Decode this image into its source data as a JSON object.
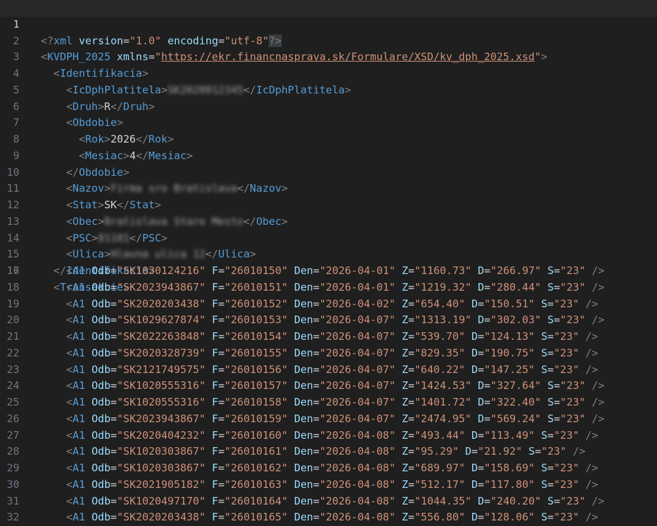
{
  "line_numbers": [
    "1",
    "2",
    "3",
    "4",
    "5",
    "6",
    "7",
    "8",
    "9",
    "10",
    "11",
    "12",
    "13",
    "14",
    "15",
    "16",
    "17",
    "18",
    "19",
    "20",
    "21",
    "22",
    "23",
    "24",
    "25",
    "26",
    "27",
    "28",
    "29",
    "30",
    "31",
    "32"
  ],
  "header": {
    "xml_decl_name": "xml",
    "version_attr": "version",
    "version_val": "\"1.0\"",
    "encoding_attr": "encoding",
    "encoding_val": "\"utf-8\"",
    "root_tag": "KVDPH_2025",
    "xmlns_attr": "xmlns",
    "xmlns_url": "https://ekr.financnasprava.sk/Formulare/XSD/kv_dph_2025.xsd"
  },
  "identifikacia": {
    "tag": "Identifikacia",
    "ic_tag": "IcDphPlatitela",
    "ic_value_blurred": "SK2020012345",
    "druh_tag": "Druh",
    "druh_value": "R",
    "obdobie_tag": "Obdobie",
    "rok_tag": "Rok",
    "rok_value": "2026",
    "mesiac_tag": "Mesiac",
    "mesiac_value": "4",
    "nazov_tag": "Nazov",
    "nazov_value_blurred": "Firma sro Bratislava",
    "stat_tag": "Stat",
    "stat_value": "SK",
    "obec_tag": "Obec",
    "obec_value_blurred": "Bratislava Stare Mesto",
    "psc_tag": "PSC",
    "psc_value_blurred": "81101",
    "ulica_tag": "Ulica",
    "ulica_value_blurred": "Hlavna ulica 12"
  },
  "transakcie_tag": "Transakcie",
  "transactions": [
    {
      "tag": "A1",
      "odb": "\"SK1030124216\"",
      "f": "\"26010150\"",
      "den": "\"2026-04-01\"",
      "z": "\"1160.73\"",
      "d": "\"266.97\"",
      "s": "\"23\""
    },
    {
      "tag": "A1",
      "odb": "\"SK2023943867\"",
      "f": "\"26010151\"",
      "den": "\"2026-04-01\"",
      "z": "\"1219.32\"",
      "d": "\"280.44\"",
      "s": "\"23\""
    },
    {
      "tag": "A1",
      "odb": "\"SK2020203438\"",
      "f": "\"26010152\"",
      "den": "\"2026-04-02\"",
      "z": "\"654.40\"",
      "d": "\"150.51\"",
      "s": "\"23\""
    },
    {
      "tag": "A1",
      "odb": "\"SK1029627874\"",
      "f": "\"26010153\"",
      "den": "\"2026-04-07\"",
      "z": "\"1313.19\"",
      "d": "\"302.03\"",
      "s": "\"23\""
    },
    {
      "tag": "A1",
      "odb": "\"SK2022263848\"",
      "f": "\"26010154\"",
      "den": "\"2026-04-07\"",
      "z": "\"539.70\"",
      "d": "\"124.13\"",
      "s": "\"23\""
    },
    {
      "tag": "A1",
      "odb": "\"SK2020328739\"",
      "f": "\"26010155\"",
      "den": "\"2026-04-07\"",
      "z": "\"829.35\"",
      "d": "\"190.75\"",
      "s": "\"23\""
    },
    {
      "tag": "A1",
      "odb": "\"SK2121749575\"",
      "f": "\"26010156\"",
      "den": "\"2026-04-07\"",
      "z": "\"640.22\"",
      "d": "\"147.25\"",
      "s": "\"23\""
    },
    {
      "tag": "A1",
      "odb": "\"SK1020555316\"",
      "f": "\"26010157\"",
      "den": "\"2026-04-07\"",
      "z": "\"1424.53\"",
      "d": "\"327.64\"",
      "s": "\"23\""
    },
    {
      "tag": "A1",
      "odb": "\"SK1020555316\"",
      "f": "\"26010158\"",
      "den": "\"2026-04-07\"",
      "z": "\"1401.72\"",
      "d": "\"322.40\"",
      "s": "\"23\""
    },
    {
      "tag": "A1",
      "odb": "\"SK2023943867\"",
      "f": "\"26010159\"",
      "den": "\"2026-04-07\"",
      "z": "\"2474.95\"",
      "d": "\"569.24\"",
      "s": "\"23\""
    },
    {
      "tag": "A1",
      "odb": "\"SK2020404232\"",
      "f": "\"26010160\"",
      "den": "\"2026-04-08\"",
      "z": "\"493.44\"",
      "d": "\"113.49\"",
      "s": "\"23\""
    },
    {
      "tag": "A1",
      "odb": "\"SK1020303867\"",
      "f": "\"26010161\"",
      "den": "\"2026-04-08\"",
      "z": "\"95.29\"",
      "d": "\"21.92\"",
      "s": "\"23\""
    },
    {
      "tag": "A1",
      "odb": "\"SK1020303867\"",
      "f": "\"26010162\"",
      "den": "\"2026-04-08\"",
      "z": "\"689.97\"",
      "d": "\"158.69\"",
      "s": "\"23\""
    },
    {
      "tag": "A1",
      "odb": "\"SK2021905182\"",
      "f": "\"26010163\"",
      "den": "\"2026-04-08\"",
      "z": "\"512.17\"",
      "d": "\"117.80\"",
      "s": "\"23\""
    },
    {
      "tag": "A1",
      "odb": "\"SK1020497170\"",
      "f": "\"26010164\"",
      "den": "\"2026-04-08\"",
      "z": "\"1044.35\"",
      "d": "\"240.20\"",
      "s": "\"23\""
    },
    {
      "tag": "A1",
      "odb": "\"SK2020203438\"",
      "f": "\"26010165\"",
      "den": "\"2026-04-08\"",
      "z": "\"556.80\"",
      "d": "\"128.06\"",
      "s": "\"23\""
    }
  ],
  "attr_names": {
    "odb": "Odb",
    "f": "F",
    "den": "Den",
    "z": "Z",
    "d": "D",
    "s": "S"
  },
  "colors": {
    "background": "#1f1f1f",
    "tag": "#569cd6",
    "attribute": "#9cdcfe",
    "string": "#ce9178",
    "text": "#d4d4d4",
    "bracket": "#808080",
    "line_number": "#6e7681"
  }
}
